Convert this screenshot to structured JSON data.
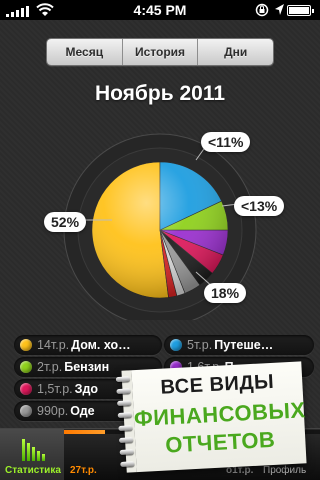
{
  "status_bar": {
    "time": "4:45 PM",
    "icons": [
      "signal-icon",
      "wifi-icon",
      "rotation-lock-icon",
      "location-arrow-icon",
      "battery-icon"
    ]
  },
  "segmented": {
    "items": [
      {
        "label": "Месяц"
      },
      {
        "label": "История"
      },
      {
        "label": "Дни"
      }
    ]
  },
  "title": "Ноябрь 2011",
  "chart_data": {
    "type": "pie",
    "title": "Ноябрь 2011",
    "slices": [
      {
        "label": "Дом. хо...",
        "value": 52,
        "color": "#ffc21a"
      },
      {
        "label": "Путеше...",
        "value": 18,
        "color": "#1e9ee0"
      },
      {
        "label": "Бензин",
        "value": 7,
        "color": "#8fd11c"
      },
      {
        "label": "Пу...",
        "value": 6,
        "color": "#9b2fd0"
      },
      {
        "label": "Здо...",
        "value": 5,
        "color": "#e0185c"
      },
      {
        "label": "other-1",
        "value": 4,
        "color": "#1e1e1e"
      },
      {
        "label": "Оде...",
        "value": 4,
        "color": "#9a9a9a"
      },
      {
        "label": "other-2",
        "value": 2,
        "color": "#d9d9d9"
      },
      {
        "label": "other-3",
        "value": 2,
        "color": "#d62222"
      }
    ],
    "callouts": [
      "52%",
      "18%",
      "<13%",
      "<11%"
    ]
  },
  "legend": {
    "items": [
      {
        "amount": "14т.р.",
        "name": "Дом. хо…",
        "color": "#ffc21a"
      },
      {
        "amount": "5т.р.",
        "name": "Путеше…",
        "color": "#1e9ee0"
      },
      {
        "amount": "2т.р.",
        "name": "Бензин",
        "color": "#8fd11c"
      },
      {
        "amount": "1,6т.р.",
        "name": "П…",
        "color": "#9b2fd0"
      },
      {
        "amount": "1,5т.р.",
        "name": "Здо",
        "color": "#e0185c"
      },
      {
        "amount": "990р.",
        "name": "Оде",
        "color": "#9a9a9a"
      }
    ]
  },
  "promo": {
    "line1": "ВСЕ ВИДЫ",
    "line2": "ФИНАНСОВЫХ",
    "line3": "ОТЧЕТОВ"
  },
  "tab_bar": {
    "active_tab": "Статистика",
    "progress_label": "27т.р.",
    "right_amount": "о1т.р.",
    "profile_tab": "Профиль",
    "progress_fraction": 0.16,
    "accent": "#ff8a00"
  }
}
